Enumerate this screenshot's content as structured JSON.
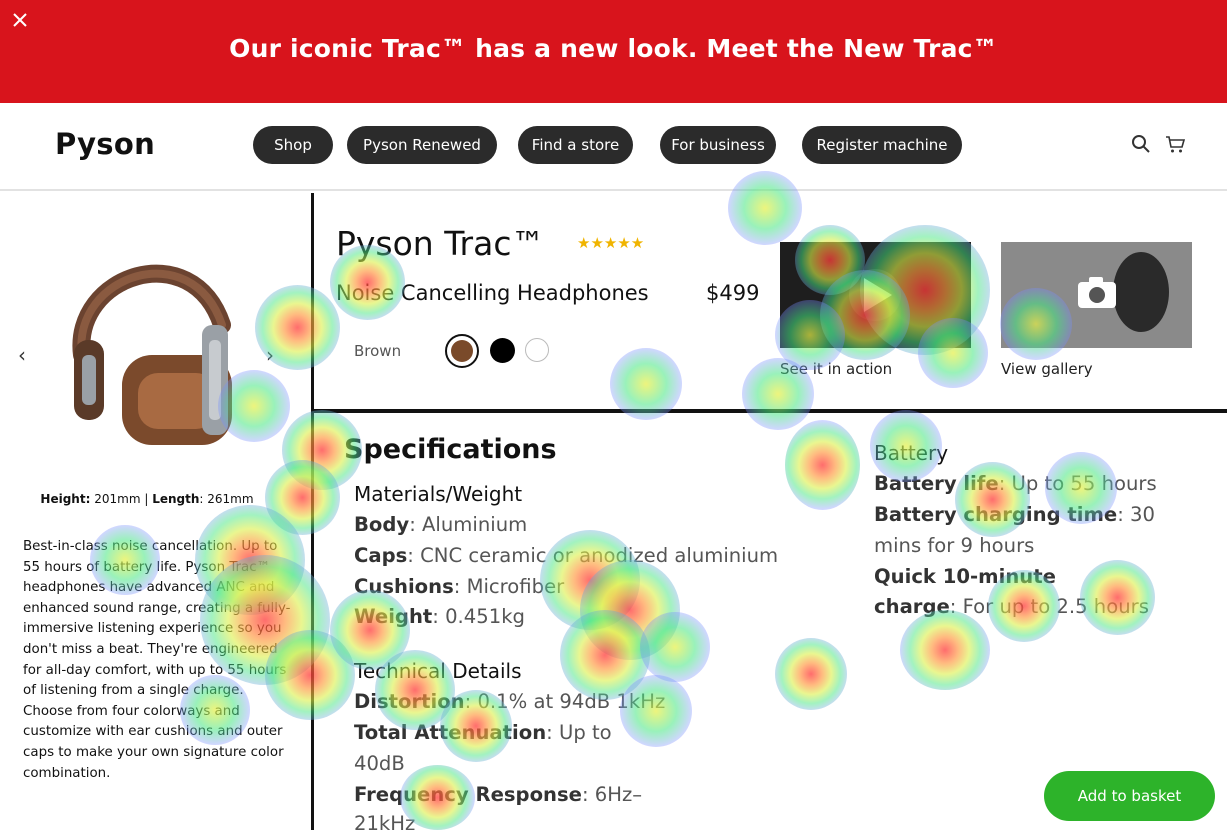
{
  "promo": {
    "text": "Our iconic Trac™ has a new look. Meet the New Trac™",
    "background": "#d8141c"
  },
  "header": {
    "logo": "Pyson",
    "nav": [
      {
        "label": "Shop"
      },
      {
        "label": "Pyson Renewed"
      },
      {
        "label": "Find a store"
      },
      {
        "label": "For business"
      },
      {
        "label": "Register machine"
      }
    ],
    "icons": [
      "search-icon",
      "cart-icon"
    ]
  },
  "gallery": {
    "dims_height_label": "Height:",
    "dims_height_value": "201mm",
    "dims_sep": "|",
    "dims_length_label": "Length",
    "dims_length_value": ": 261mm",
    "description": "Best-in-class noise cancellation. Up to 55 hours of battery life. Pyson Trac™ headphones have advanced ANC and enhanced sound range, creating a fully-immersive listening experience so you don't miss a beat. They're engineered for all-day comfort, with up to 55 hours of listening from a single charge. Choose from four colorways and customize with ear cushions and outer caps to make your own signature color combination."
  },
  "product": {
    "title": "Pyson Trac™",
    "stars": "★★★★★",
    "rating": 5,
    "subtitle": "Noise Cancelling Headphones",
    "price": "$499",
    "color_label": "Brown",
    "swatches": [
      "#7a4a2a",
      "#000000",
      "#ffffff"
    ],
    "media": [
      {
        "caption": "See it in action"
      },
      {
        "caption": "View gallery"
      }
    ]
  },
  "specs": {
    "heading": "Specifications",
    "materials": {
      "heading": "Materials/Weight",
      "items": [
        {
          "k": "Body",
          "v": ": Aluminium"
        },
        {
          "k": "Caps",
          "v": ": CNC ceramic or anodized aluminium"
        },
        {
          "k": "Cushions",
          "v": ": Microfiber"
        },
        {
          "k": "Weight",
          "v": ": 0.451kg"
        }
      ]
    },
    "technical": {
      "heading": "Technical Details",
      "items": [
        {
          "k": "Distortion",
          "v": ": 0.1% at 94dB 1kHz"
        },
        {
          "k": "Total Attenuation",
          "v": ": Up to"
        },
        {
          "k": "",
          "v": "40dB"
        },
        {
          "k": "Frequency Response",
          "v": ": 6Hz–"
        },
        {
          "k": "",
          "v": "21kHz"
        }
      ]
    },
    "battery": {
      "heading": "Battery",
      "items": [
        {
          "k": "Battery life",
          "v": ": Up to 55 hours"
        },
        {
          "k": "Battery charging time",
          "v": ": 30"
        },
        {
          "k": "",
          "v": "mins for 9 hours"
        },
        {
          "k": "Quick 10-minute",
          "v": ""
        },
        {
          "k": "charge",
          "v": ": For up to 2.5 hours"
        }
      ]
    }
  },
  "cta": {
    "basket": "Add to basket",
    "color": "#2db32a"
  }
}
